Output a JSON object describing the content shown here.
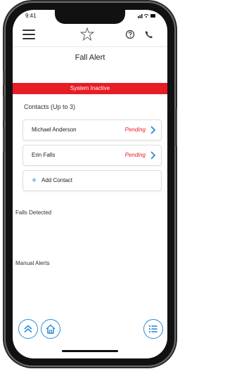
{
  "status_bar": {
    "time": "9:41",
    "signal_icons": "signal-wifi-battery"
  },
  "header": {
    "title": "Fall Alert"
  },
  "alert_bar": {
    "text": "System Inactive",
    "color": "#e81c24"
  },
  "contacts": {
    "heading": "Contacts (Up to 3)",
    "items": [
      {
        "name": "Michael Anderson",
        "status": "Pending"
      },
      {
        "name": "Erin Falls",
        "status": "Pending"
      }
    ],
    "add_label": "Add Contact"
  },
  "sections": {
    "falls_detected": "Falls Detected",
    "manual_alerts": "Manual Alerts"
  },
  "icons": {
    "menu": "hamburger-icon",
    "logo": "star-logo-icon",
    "help": "help-icon",
    "call": "phone-call-icon",
    "scroll_up": "chevron-up-icon",
    "home": "home-icon",
    "list": "list-icon"
  },
  "colors": {
    "accent": "#2a8bd8",
    "alert": "#e81c24"
  }
}
